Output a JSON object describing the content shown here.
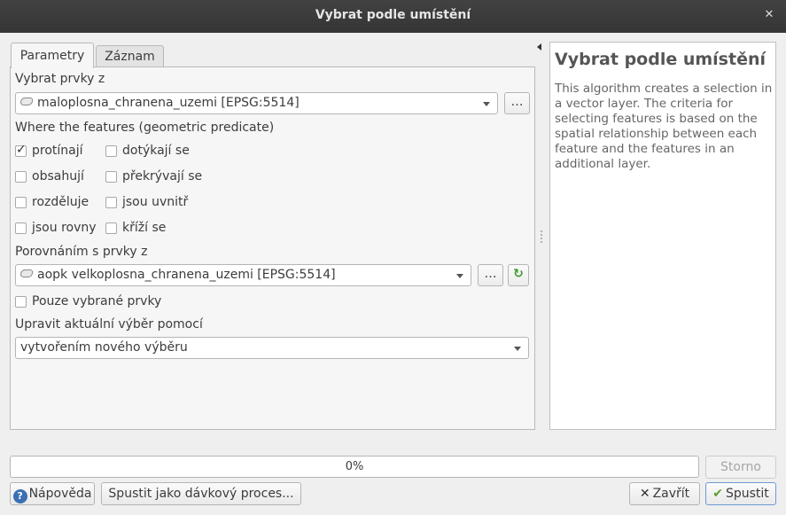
{
  "window": {
    "title": "Vybrat podle umístění"
  },
  "tabs": [
    {
      "label": "Parametry"
    },
    {
      "label": "Záznam"
    }
  ],
  "form": {
    "select_features_label": "Vybrat prvky z",
    "select_features_value": "maloplosna_chranena_uzemi [EPSG:5514]",
    "predicate_label": "Where the features (geometric predicate)",
    "predicates": [
      {
        "label": "protínají",
        "checked": true
      },
      {
        "label": "dotýkají se",
        "checked": false
      },
      {
        "label": "obsahují",
        "checked": false
      },
      {
        "label": "překrývají se",
        "checked": false
      },
      {
        "label": "rozděluje",
        "checked": false
      },
      {
        "label": "jsou uvnitř",
        "checked": false
      },
      {
        "label": "jsou rovny",
        "checked": false
      },
      {
        "label": "kříží se",
        "checked": false
      }
    ],
    "compare_label": "Porovnáním s prvky z",
    "compare_value": "aopk velkoplosna_chranena_uzemi [EPSG:5514]",
    "selected_only_label": "Pouze vybrané prvky",
    "selected_only_checked": false,
    "modify_label": "Upravit aktuální výběr pomocí",
    "modify_value": "vytvořením nového výběru",
    "browse_label": "…"
  },
  "help": {
    "title": "Vybrat podle umístění",
    "text": "This algorithm creates a selection in a vector layer. The criteria for selecting features is based on the spatial relationship between each feature and the features in an additional layer."
  },
  "progress": {
    "value": 0,
    "label": "0%"
  },
  "buttons": {
    "cancel": "Storno",
    "help": "Nápověda",
    "batch": "Spustit jako dávkový proces...",
    "close": "Zavřít",
    "run": "Spustit"
  },
  "colors": {
    "titlebar": "#3b3b3b",
    "background": "#efefef",
    "progress_fill": "#8db4e2"
  }
}
